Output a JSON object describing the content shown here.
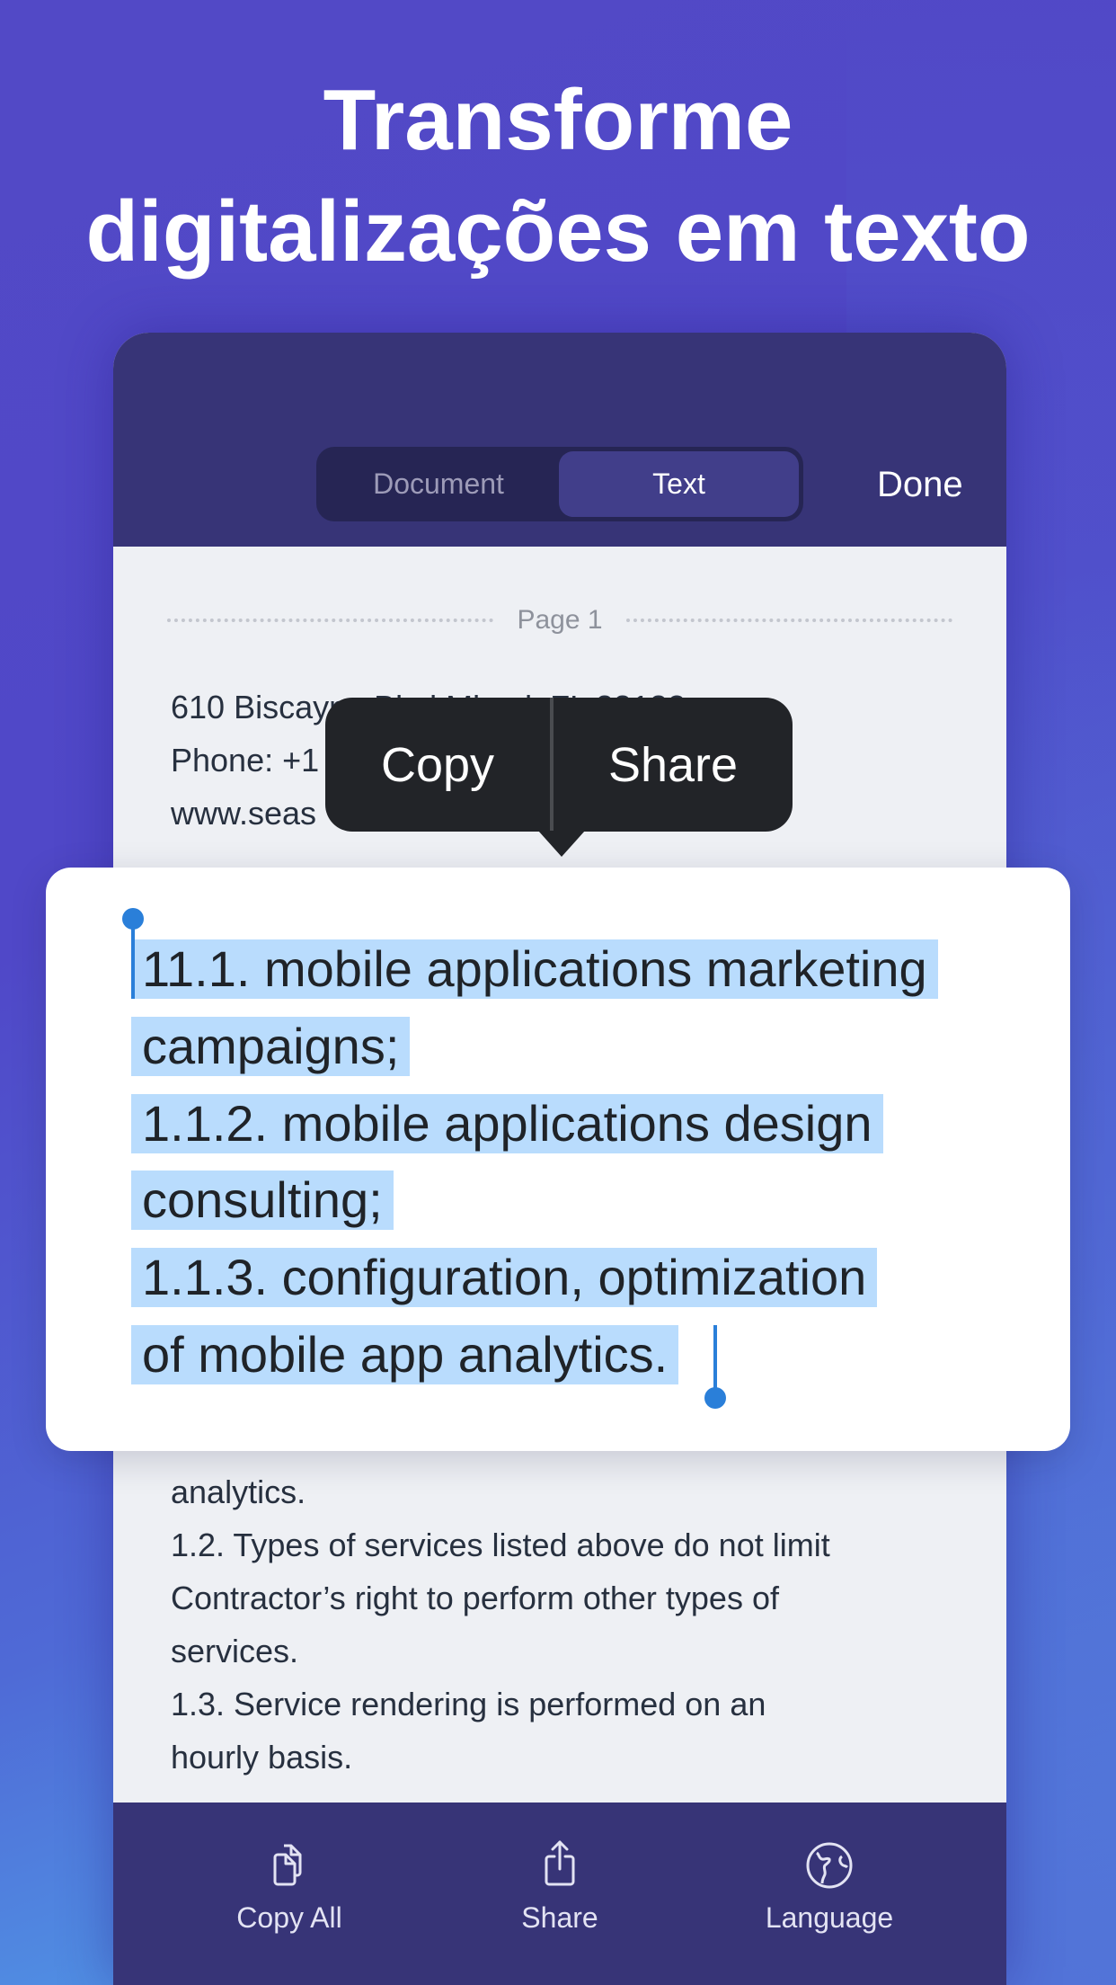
{
  "headline": {
    "line1": "Transforme",
    "line2": "digitalizações em texto"
  },
  "nav": {
    "segments": [
      {
        "label": "Document",
        "selected": false
      },
      {
        "label": "Text",
        "selected": true
      }
    ],
    "done_label": "Done"
  },
  "document": {
    "page_label": "Page 1",
    "top_lines": [
      "610 Biscayne Blvd Miami, FL 33132",
      "Phone: +1",
      "www.seas"
    ],
    "bottom_lines": [
      "analytics.",
      "1.2. Types of services listed above do not limit",
      "Contractor’s right to perform other types of",
      "services.",
      "1.3. Service rendering is performed on an",
      "hourly basis."
    ]
  },
  "context_menu": {
    "copy_label": "Copy",
    "share_label": "Share"
  },
  "selection": {
    "lines": [
      "11.1. mobile applications marketing",
      "campaigns;",
      "1.1.2. mobile applications design",
      "consulting;",
      "1.1.3. configuration, optimization",
      "of mobile app analytics."
    ],
    "highlight_color": "#b9dcfd",
    "handle_color": "#2a7fd9"
  },
  "bottom_bar": {
    "items": [
      {
        "label": "Copy All",
        "icon": "copy-documents-icon"
      },
      {
        "label": "Share",
        "icon": "share-icon"
      },
      {
        "label": "Language",
        "icon": "globe-icon"
      }
    ]
  },
  "colors": {
    "nav_bg": "#373477",
    "content_bg": "#eef0f4",
    "popup_bg": "#222428"
  }
}
